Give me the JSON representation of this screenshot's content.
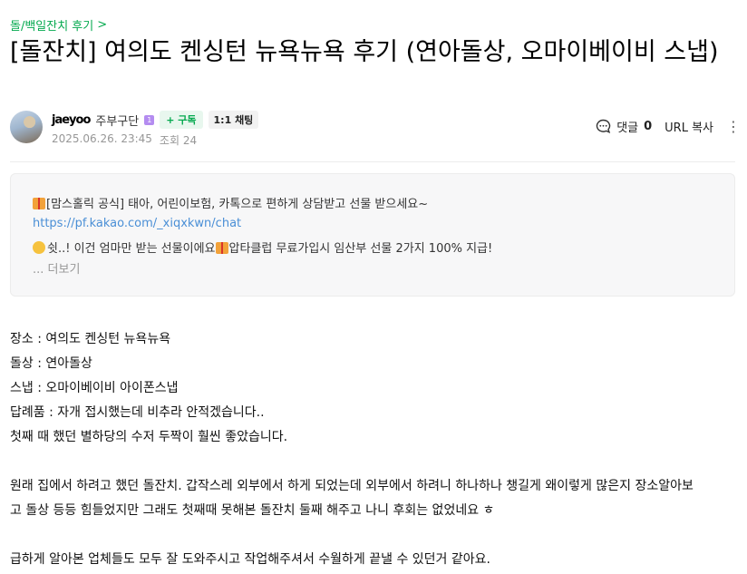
{
  "breadcrumb": {
    "label": "돌/백일잔치 후기",
    "arrow": ">"
  },
  "title": "[돌잔치] 여의도 켄싱턴 뉴욕뉴욕 후기 (연아돌상, 오마이베이비 스냅)",
  "author": {
    "nickname": "jaeyoo",
    "grade": "주부구단",
    "grade_badge": "1",
    "subscribe_label": "+ 구독",
    "chat_label": "1:1 채팅",
    "date": "2025.06.26. 23:45",
    "views": "조회 24"
  },
  "tools": {
    "comment_label": "댓글",
    "comment_count": "0",
    "url_copy": "URL 복사",
    "more": "⋮"
  },
  "ad": {
    "line1": "[맘스홀릭 공식] 태아, 어린이보험, 카톡으로 편하게 상담받고 선물 받으세요~",
    "link": "https://pf.kakao.com/_xiqxkwn/chat",
    "line3a": "쉿..! 이건 엄마만 받는 선물이에요",
    "line3b": "압타클럽 무료가입시 임산부 선물 2가지 100% 지급!",
    "more": "... 더보기"
  },
  "body": [
    "장소 : 여의도 켄싱턴 뉴욕뉴욕",
    "돌상 : 연아돌상",
    "스냅 : 오마이베이비 아이폰스냅",
    "답례품 : 자개 접시했는데 비추라 안적겠습니다..",
    "첫째 때 했던 별하당의 수저 두짝이 훨씬 좋았습니다.",
    "원래 집에서 하려고 했던 돌잔치. 갑작스레 외부에서 하게 되었는데 외부에서 하려니 하나하나 챙길게 왜이렇게 많은지 장소알아보",
    "고 돌상 등등 힘들었지만 그래도 첫째때 못해본 돌잔치 둘째 해주고 나니 후회는 없었네요 ㅎ",
    "급하게 알아본 업체들도 모두 잘 도와주시고 작업해주셔서 수월하게 끝낼 수 있던거 같아요."
  ]
}
